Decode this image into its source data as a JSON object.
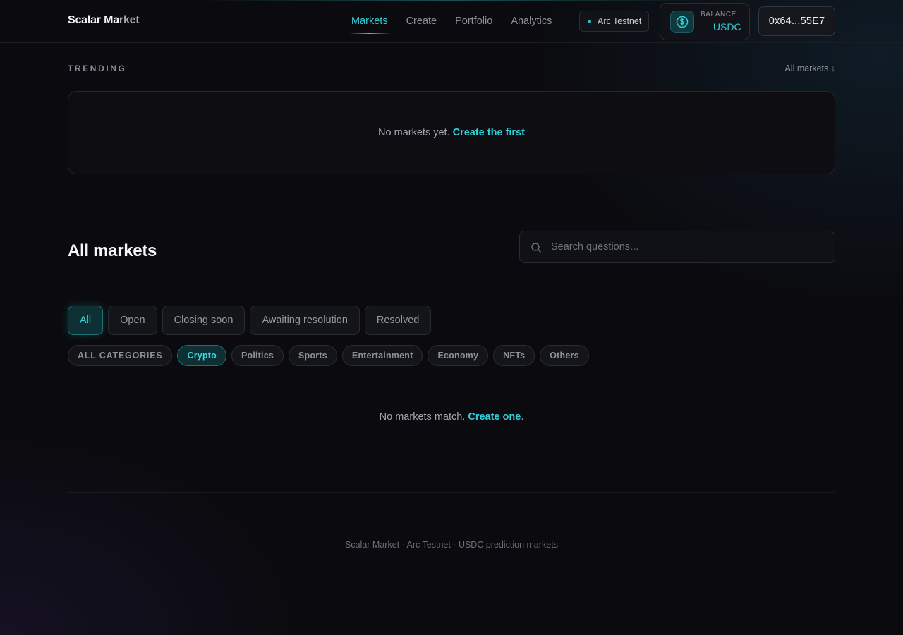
{
  "header": {
    "brand_primary": "Scalar Ma",
    "brand_fade": "rket",
    "nav": [
      {
        "label": "Markets",
        "active": true
      },
      {
        "label": "Create"
      },
      {
        "label": "Portfolio"
      },
      {
        "label": "Analytics"
      }
    ],
    "network": "Arc Testnet",
    "balance_label": "BALANCE",
    "balance_value": "—",
    "balance_unit": "USDC",
    "wallet": "0x64...55E7"
  },
  "trending": {
    "label": "TRENDING",
    "all_link": "All markets ↓",
    "empty_text": "No markets yet.",
    "empty_link": "Create the first"
  },
  "markets": {
    "title": "All markets",
    "search_placeholder": "Search questions...",
    "status_tabs": [
      "All",
      "Open",
      "Closing soon",
      "Awaiting resolution",
      "Resolved"
    ],
    "active_status": "All",
    "categories": [
      "ALL CATEGORIES",
      "Crypto",
      "Politics",
      "Sports",
      "Entertainment",
      "Economy",
      "NFTs",
      "Others"
    ],
    "active_category": "Crypto",
    "empty_text": "No markets match.",
    "empty_link": "Create one",
    "empty_tail": "."
  },
  "footer": {
    "text": "Scalar Market · Arc Testnet · USDC prediction markets"
  },
  "colors": {
    "accent": "#2fd0d6",
    "background": "#0b0b0f"
  }
}
